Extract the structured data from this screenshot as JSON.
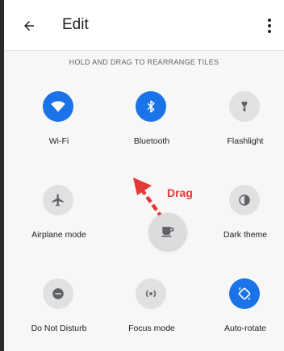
{
  "appbar": {
    "title": "Edit",
    "back_icon": "arrow-back-icon",
    "menu_icon": "more-vert-icon"
  },
  "hint": "HOLD AND DRAG TO REARRANGE TILES",
  "tiles": [
    {
      "label": "Wi-Fi",
      "icon": "wifi-icon",
      "active": true
    },
    {
      "label": "Bluetooth",
      "icon": "bluetooth-icon",
      "active": true
    },
    {
      "label": "Flashlight",
      "icon": "flashlight-icon",
      "active": false
    },
    {
      "label": "Airplane mode",
      "icon": "airplane-icon",
      "active": false
    },
    {
      "label": "Dark theme",
      "icon": "dark-theme-icon",
      "active": false
    },
    {
      "label": "Do Not Disturb",
      "icon": "do-not-disturb-icon",
      "active": false
    },
    {
      "label": "Focus mode",
      "icon": "focus-mode-icon",
      "active": false
    },
    {
      "label": "Auto-rotate",
      "icon": "auto-rotate-icon",
      "active": true
    }
  ],
  "dragged_tile": {
    "icon": "coffee-cup-icon"
  },
  "annotation": {
    "label": "Drag",
    "color": "#e53935"
  },
  "colors": {
    "active": "#1a73e8",
    "inactive": "#e1e1e1",
    "background": "#f7f7f7"
  }
}
